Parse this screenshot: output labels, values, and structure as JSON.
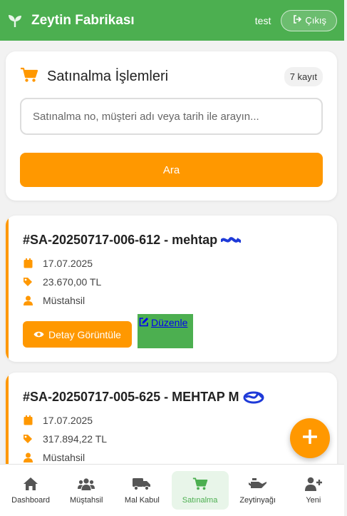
{
  "header": {
    "brand": "Zeytin Fabrikası",
    "user": "test",
    "logout_label": "Çıkış",
    "brand_color": "#4caf50"
  },
  "search": {
    "title": "Satınalma İşlemleri",
    "count_badge": "7 kayıt",
    "placeholder": "Satınalma no, müşteri adı veya tarih ile arayın...",
    "button_label": "Ara"
  },
  "orders": [
    {
      "title": "#SA-20250717-006-612 - mehtap",
      "date": "17.07.2025",
      "amount": "23.670,00 TL",
      "type": "Müstahsil",
      "detail_label": "Detay Görüntüle",
      "edit_label": "Düzenle"
    },
    {
      "title": "#SA-20250717-005-625 - MEHTAP M",
      "date": "17.07.2025",
      "amount": "317.894,22 TL",
      "type": "Müstahsil"
    }
  ],
  "nav": [
    {
      "label": "Dashboard",
      "icon": "home-icon"
    },
    {
      "label": "Müştahsil",
      "icon": "users-icon"
    },
    {
      "label": "Mal Kabul",
      "icon": "truck-icon"
    },
    {
      "label": "Satınalma",
      "icon": "cart-icon",
      "active": true
    },
    {
      "label": "Zeytinyağı",
      "icon": "oil-can-icon"
    },
    {
      "label": "Yeni",
      "icon": "user-plus-icon"
    }
  ],
  "colors": {
    "accent": "#ff9800",
    "primary": "#4caf50"
  }
}
